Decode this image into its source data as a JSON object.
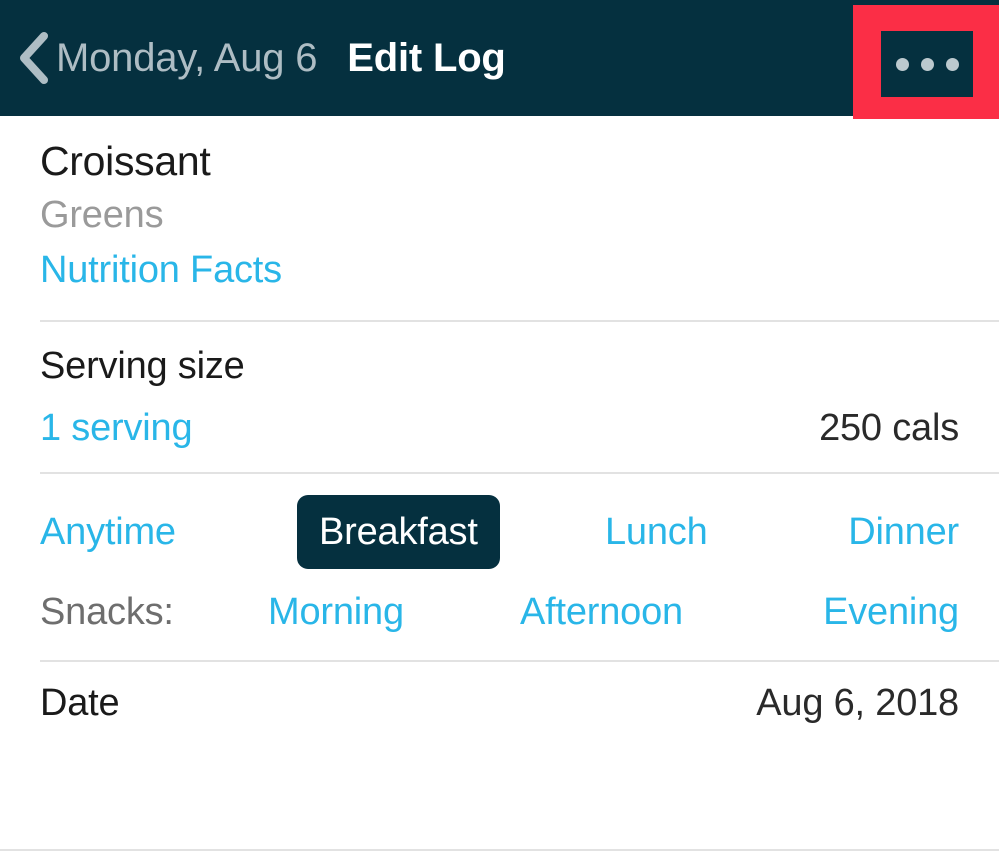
{
  "navbar": {
    "back_icon": "chevron-left-icon",
    "back_label": "Monday, Aug 6",
    "title": "Edit Log",
    "more_icon": "more-horizontal-icon",
    "highlight_color": "#FB2E46",
    "background_color": "#05303F",
    "back_label_color": "#AEBDC4"
  },
  "theme": {
    "accent": "#29B6E8",
    "dark": "#05303F",
    "divider": "#E2E2E2",
    "muted": "#9A9A9A"
  },
  "food": {
    "name": "Croissant",
    "brand": "Greens",
    "nutrition_link": "Nutrition Facts"
  },
  "serving": {
    "label": "Serving size",
    "value": "1 serving",
    "calories": "250 cals"
  },
  "meal": {
    "options": [
      {
        "label": "Anytime",
        "selected": false
      },
      {
        "label": "Breakfast",
        "selected": true
      },
      {
        "label": "Lunch",
        "selected": false
      },
      {
        "label": "Dinner",
        "selected": false
      }
    ],
    "snacks_label": "Snacks:",
    "snack_options": [
      {
        "label": "Morning",
        "selected": false
      },
      {
        "label": "Afternoon",
        "selected": false
      },
      {
        "label": "Evening",
        "selected": false
      }
    ]
  },
  "date": {
    "label": "Date",
    "value": "Aug 6, 2018"
  }
}
